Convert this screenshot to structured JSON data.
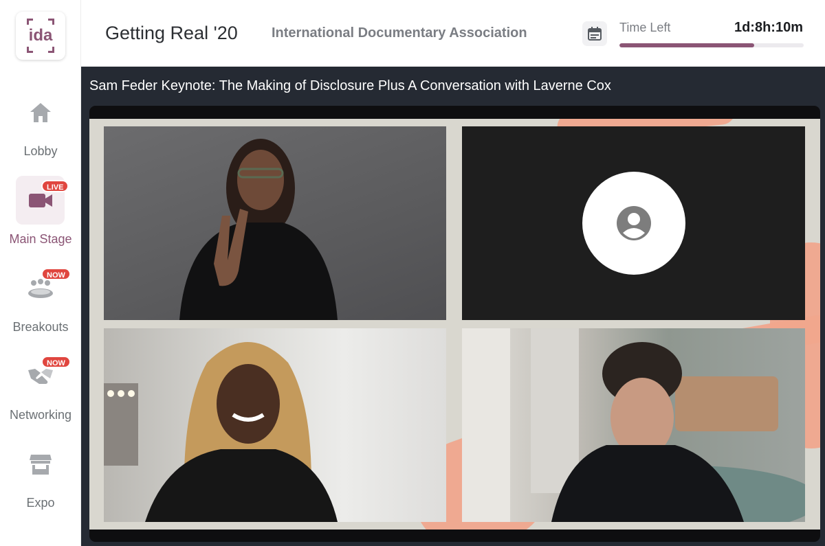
{
  "brand": {
    "logo_text": "ida",
    "accent_color": "#8b5575"
  },
  "sidebar": {
    "items": [
      {
        "label": "Lobby",
        "icon": "home-icon",
        "badge": ""
      },
      {
        "label": "Main Stage",
        "icon": "video-camera-icon",
        "badge": "LIVE",
        "active": true
      },
      {
        "label": "Breakouts",
        "icon": "people-table-icon",
        "badge": "NOW"
      },
      {
        "label": "Networking",
        "icon": "handshake-icon",
        "badge": "NOW"
      },
      {
        "label": "Expo",
        "icon": "booth-icon",
        "badge": ""
      }
    ]
  },
  "header": {
    "event_title": "Getting Real '20",
    "organization": "International Documentary Association",
    "calendar_icon": "calendar-icon",
    "time_left_label": "Time Left",
    "time_left_value": "1d:8h:10m",
    "time_progress_fraction": 0.73
  },
  "stage": {
    "session_title": "Sam Feder Keynote: The Making of Disclosure Plus A Conversation with Laverne Cox",
    "participants": [
      {
        "kind": "video",
        "description_icon": "participant-video"
      },
      {
        "kind": "avatar",
        "icon": "user-avatar-icon"
      },
      {
        "kind": "video",
        "description_icon": "participant-video"
      },
      {
        "kind": "video",
        "description_icon": "participant-video"
      }
    ]
  }
}
